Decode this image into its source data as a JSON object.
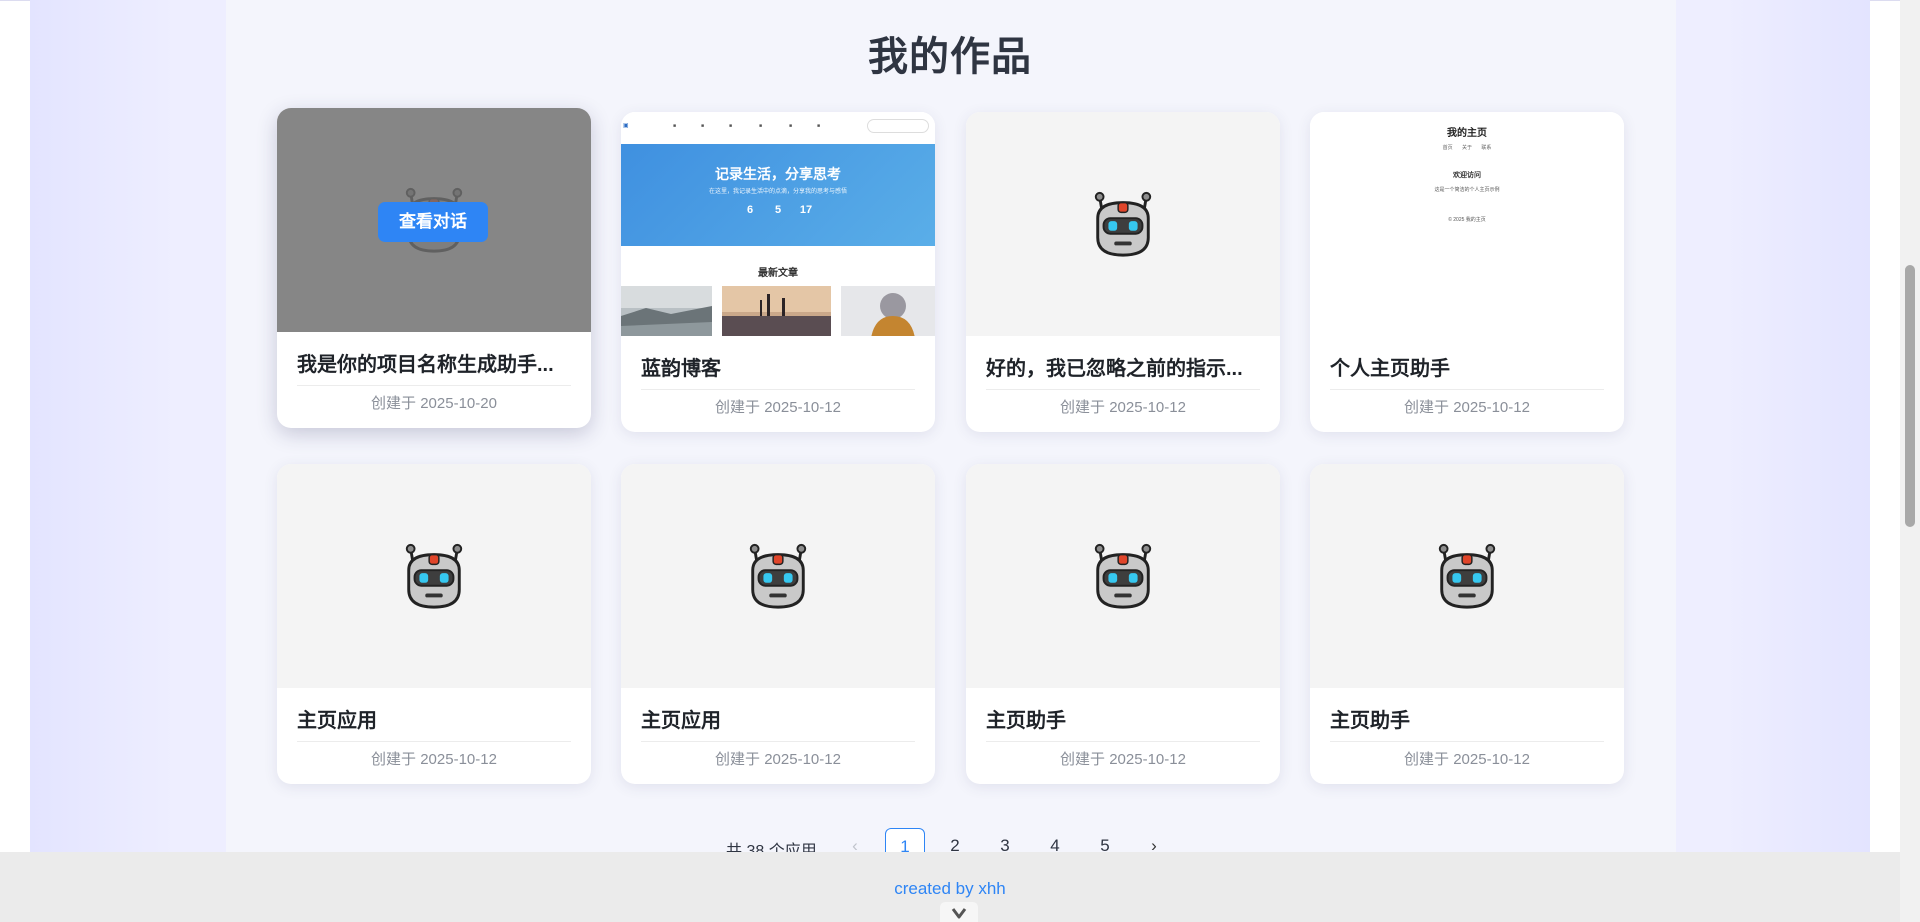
{
  "section_title": "我的作品",
  "cards": [
    {
      "title": "我是你的项目名称生成助手...",
      "date": "创建于 2025-10-20",
      "thumbnail": "robot-icon",
      "overlay_button": "查看对话"
    },
    {
      "title": "蓝韵博客",
      "date": "创建于 2025-10-12",
      "thumbnail": "blog-preview"
    },
    {
      "title": "好的，我已忽略之前的指示...",
      "date": "创建于 2025-10-12",
      "thumbnail": "robot-icon"
    },
    {
      "title": "个人主页助手",
      "date": "创建于 2025-10-12",
      "thumbnail": "homepage-preview"
    },
    {
      "title": "主页应用",
      "date": "创建于 2025-10-12",
      "thumbnail": "robot-icon"
    },
    {
      "title": "主页应用",
      "date": "创建于 2025-10-12",
      "thumbnail": "robot-icon"
    },
    {
      "title": "主页助手",
      "date": "创建于 2025-10-12",
      "thumbnail": "robot-icon"
    },
    {
      "title": "主页助手",
      "date": "创建于 2025-10-12",
      "thumbnail": "robot-icon"
    }
  ],
  "blog_preview": {
    "hero_title": "记录生活，分享思考",
    "hero_subtitle": "在这里，我记录生活中的点滴，分享我的思考与感悟",
    "stats": [
      "6",
      "5",
      "17"
    ],
    "latest_heading": "最新文章"
  },
  "homepage_preview": {
    "title": "我的主页",
    "nav": "首页 关于 联系",
    "welcome": "欢迎访问",
    "line": "这是一个简洁的个人主页示例",
    "footer": "© 2025 我的主页"
  },
  "pagination": {
    "total_text": "共 38 个应用",
    "pages": [
      "1",
      "2",
      "3",
      "4",
      "5"
    ],
    "current_page": "1",
    "prev_icon": "chevron-left-icon",
    "next_icon": "chevron-right-icon"
  },
  "footer": {
    "text": "created by xhh",
    "toggle_icon": "chevron-down-icon"
  },
  "colors": {
    "accent": "#2e85f5",
    "title": "#2f3542",
    "background": "#f4f5fc"
  }
}
